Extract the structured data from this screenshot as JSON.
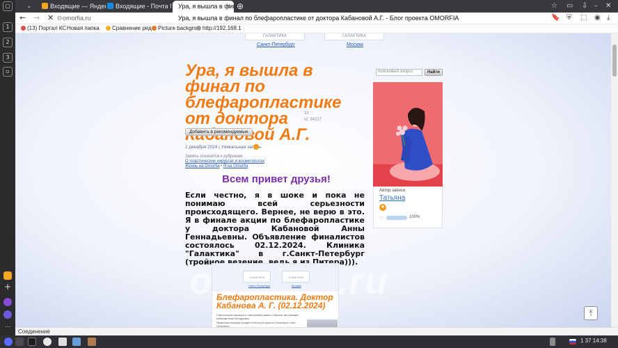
{
  "browser": {
    "tabs": [
      {
        "label": "Входящие — Яндекс П",
        "color": "#f5a623"
      },
      {
        "label": "Входящие - Почта Ма",
        "color": "#168de2"
      },
      {
        "label": "Ура, я вышла в фин",
        "active": true
      }
    ],
    "url": "omorfia.ru",
    "page_title": "Ура, я вышла в финал по блефаропластике от доктора Кабановой А.Г. - Блог проекта OMORFIA",
    "bookmarks": [
      "(13) Портал КС",
      "Новая папка",
      "Сравнение ред",
      "Picture backgro",
      "http://192.168.1"
    ],
    "status_text": "Соединение"
  },
  "clinics": [
    {
      "name": "ГАЛАКТИКА",
      "city": "Санкт-Петербург"
    },
    {
      "name": "ГАЛАКТИКА",
      "city": "Москва"
    }
  ],
  "article": {
    "title": "Ура, я вышла в финал по блефаропластике от доктора Кабановой А.Г.",
    "likes": "33",
    "id_label": "Id: 34317",
    "recommend_label": "Добавить в рекомендуемые",
    "date_line": "2 декабря 2024 | Уникальная запись",
    "rubric_intro": "Запись относится к рубрикам:",
    "rubric_1": "О пластических хирургах и косметологах",
    "rubric_2": "Жизнь на Omorfia",
    "rubric_3": "Я на Omorfia",
    "rubric_sep": " • ",
    "greeting": "Всем привет друзья!",
    "body": "Если честно, я в шоке и пока не понимаю всей серьезности происходящего. Вернее, не верю в это. Я в финале акции по блефаропластике у доктора Кабановой Анны Геннадьевны. Объявление финалистов состоялось 02.12.2024. Клиника \"Галактика\" в г.Санкт-Петербург (тройное везение, ведь я из Питера)))."
  },
  "embed": {
    "title": "Блефаропластика. Доктор Кабанова А. Г. (02.12.2024)",
    "line_1": "Пластическая операция по омоложению нижних и верхних век проводит Кабанова Анна Геннадьевна.",
    "line_2": "Первичная операция пройдет в Институте красоты Галактика в Санкт-Петербурге.",
    "card_1": "ГАЛАКТИКА",
    "card_2": "ГАЛАКТИКА",
    "city_1": "Санкт-Петербург",
    "city_2": "Москва"
  },
  "watermark": "omorfia.ru",
  "sidebar": {
    "search_placeholder": "поисковый запрос",
    "search_button": "Найти",
    "author_caption": "Автор записи",
    "author_name": "Татьяна",
    "rating_percent": "100%"
  },
  "taskbar": {
    "tray": "1  37  14:38"
  },
  "colors": {
    "title_orange": "#f07b14",
    "greeting_purple": "#7a2ea8",
    "link_blue": "#2a5db0"
  }
}
